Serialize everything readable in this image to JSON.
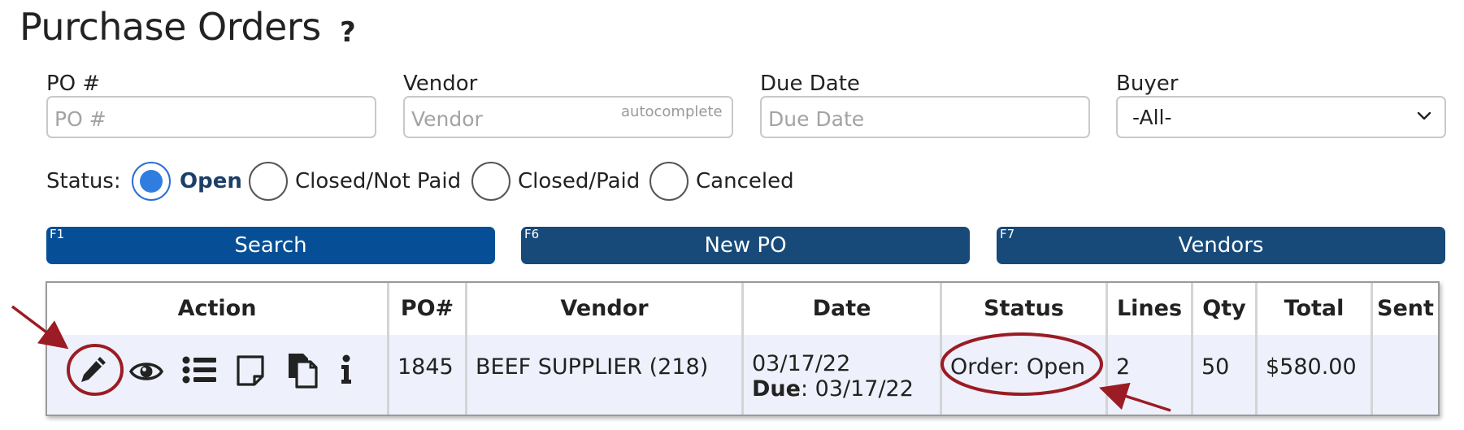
{
  "page": {
    "title": "Purchase Orders",
    "help_icon": "question-mark-icon"
  },
  "filters": {
    "po_label": "PO #",
    "po_placeholder": "PO #",
    "po_value": "",
    "vendor_label": "Vendor",
    "vendor_placeholder": "Vendor",
    "vendor_value": "",
    "vendor_hint": "autocomplete",
    "due_label": "Due Date",
    "due_placeholder": "Due Date",
    "due_value": "",
    "buyer_label": "Buyer",
    "buyer_selected": "-All-"
  },
  "status": {
    "label": "Status:",
    "options": [
      "Open",
      "Closed/Not Paid",
      "Closed/Paid",
      "Canceled"
    ],
    "selected": "Open"
  },
  "buttons": {
    "search": {
      "label": "Search",
      "key": "F1"
    },
    "new_po": {
      "label": "New PO",
      "key": "F6"
    },
    "vendors": {
      "label": "Vendors",
      "key": "F7"
    }
  },
  "table": {
    "headers": [
      "Action",
      "PO#",
      "Vendor",
      "Date",
      "Status",
      "Lines",
      "Qty",
      "Total",
      "Sent"
    ],
    "rows": [
      {
        "actions": [
          "pencil-edit-icon",
          "eye-view-icon",
          "list-icon",
          "note-icon",
          "copy-icon",
          "info-icon"
        ],
        "po": "1845",
        "vendor": "BEEF SUPPLIER (218)",
        "date": "03/17/22",
        "due_label": "Due",
        "due_sep": ": ",
        "due_date": "03/17/22",
        "status": "Order: Open",
        "lines": "2",
        "qty": "50",
        "total": "$580.00",
        "sent": ""
      }
    ]
  },
  "colors": {
    "primary_button": "#064f96",
    "secondary_button": "#174a79",
    "radio_selected": "#2f7de1",
    "row_background": "#eef1fb",
    "annotation": "#9b1c24"
  }
}
